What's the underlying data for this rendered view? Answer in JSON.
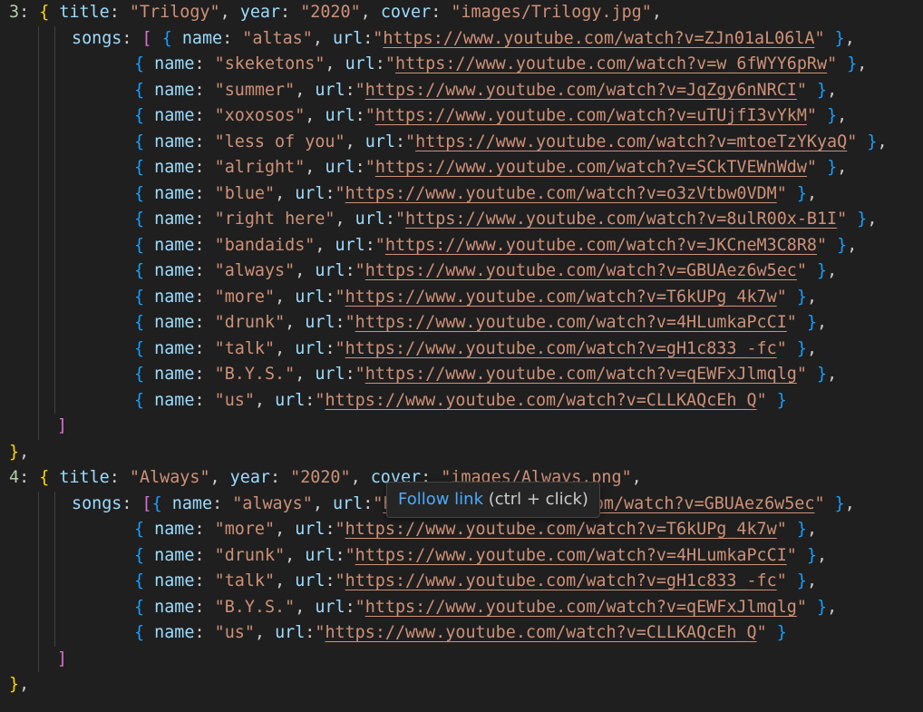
{
  "editor": {
    "albums": [
      {
        "index": "3",
        "title": "Trilogy",
        "year": "2020",
        "cover": "images/Trilogy.jpg",
        "songs": [
          {
            "name": "altas",
            "url": "https://www.youtube.com/watch?v=ZJn01aL06lA"
          },
          {
            "name": "skeketons",
            "url": "https://www.youtube.com/watch?v=w_6fWYY6pRw"
          },
          {
            "name": "summer",
            "url": "https://www.youtube.com/watch?v=JqZgy6nNRCI"
          },
          {
            "name": "xoxosos",
            "url": "https://www.youtube.com/watch?v=uTUjfI3vYkM"
          },
          {
            "name": "less of you",
            "url": "https://www.youtube.com/watch?v=mtoeTzYKyaQ"
          },
          {
            "name": "alright",
            "url": "https://www.youtube.com/watch?v=SCkTVEWnWdw"
          },
          {
            "name": "blue",
            "url": "https://www.youtube.com/watch?v=o3zVtbw0VDM"
          },
          {
            "name": "right here",
            "url": "https://www.youtube.com/watch?v=8ulR00x-B1I"
          },
          {
            "name": "bandaids",
            "url": "https://www.youtube.com/watch?v=JKCneM3C8R8"
          },
          {
            "name": "always",
            "url": "https://www.youtube.com/watch?v=GBUAez6w5ec"
          },
          {
            "name": "more",
            "url": "https://www.youtube.com/watch?v=T6kUPg_4k7w"
          },
          {
            "name": "drunk",
            "url": "https://www.youtube.com/watch?v=4HLumkaPcCI"
          },
          {
            "name": "talk",
            "url": "https://www.youtube.com/watch?v=gH1c833_-fc"
          },
          {
            "name": "B.Y.S.",
            "url": "https://www.youtube.com/watch?v=qEWFxJlmqlg"
          },
          {
            "name": "us",
            "url": "https://www.youtube.com/watch?v=CLLKAQcEh_Q"
          }
        ]
      },
      {
        "index": "4",
        "title": "Always",
        "year": "2020",
        "cover": "images/Always.png",
        "songs": [
          {
            "name": "always",
            "url": "https://www.youtube.com/watch?v=GBUAez6w5ec"
          },
          {
            "name": "more",
            "url": "https://www.youtube.com/watch?v=T6kUPg_4k7w"
          },
          {
            "name": "drunk",
            "url": "https://www.youtube.com/watch?v=4HLumkaPcCI"
          },
          {
            "name": "talk",
            "url": "https://www.youtube.com/watch?v=gH1c833_-fc"
          },
          {
            "name": "B.Y.S.",
            "url": "https://www.youtube.com/watch?v=qEWFxJlmqlg"
          },
          {
            "name": "us",
            "url": "https://www.youtube.com/watch?v=CLLKAQcEh_Q"
          }
        ]
      }
    ]
  },
  "tooltip": {
    "link_label": "Follow link",
    "hint": "(ctrl + click)"
  },
  "colors": {
    "background": "#1f1f1f",
    "key": "#9cdcfe",
    "string": "#ce9178",
    "number": "#b5cea8",
    "bracket_level1": "#ffd700",
    "bracket_level2": "#da70d6",
    "bracket_level3": "#179fff",
    "link": "#4daafc"
  }
}
